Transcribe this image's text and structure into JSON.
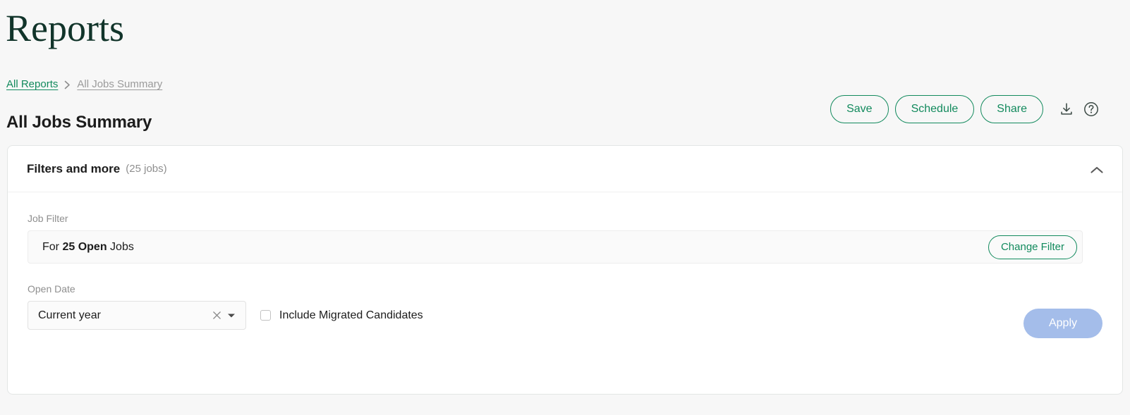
{
  "app": {
    "title": "Reports"
  },
  "breadcrumb": {
    "root_label": "All Reports",
    "separator": "›",
    "current_label": "All Jobs Summary"
  },
  "header": {
    "page_title": "All Jobs Summary",
    "actions": {
      "save_label": "Save",
      "schedule_label": "Schedule",
      "share_label": "Share",
      "download_icon": "download-icon",
      "help_icon": "help-circle-icon"
    }
  },
  "filters_card": {
    "title": "Filters and more",
    "count_label": "(25 jobs)",
    "collapse_icon": "chevron-up-icon",
    "job_filter": {
      "label": "Job Filter",
      "prefix": "For",
      "emphasis": "25 Open",
      "suffix": "Jobs",
      "change_button_label": "Change Filter"
    },
    "open_date": {
      "label": "Open Date",
      "selected_value": "Current year",
      "clear_icon": "close-icon",
      "caret_icon": "chevron-down-icon"
    },
    "include_migrated": {
      "label": "Include Migrated Candidates",
      "checked": false
    },
    "apply_label": "Apply"
  },
  "colors": {
    "brand_green": "#128a5d",
    "title_green": "#11342a",
    "text_dark": "#1c1c1c",
    "muted_gray": "#8f8f8f",
    "apply_disabled": "#a4bdea",
    "page_bg": "#f7f7f7",
    "card_bg": "#ffffff"
  }
}
